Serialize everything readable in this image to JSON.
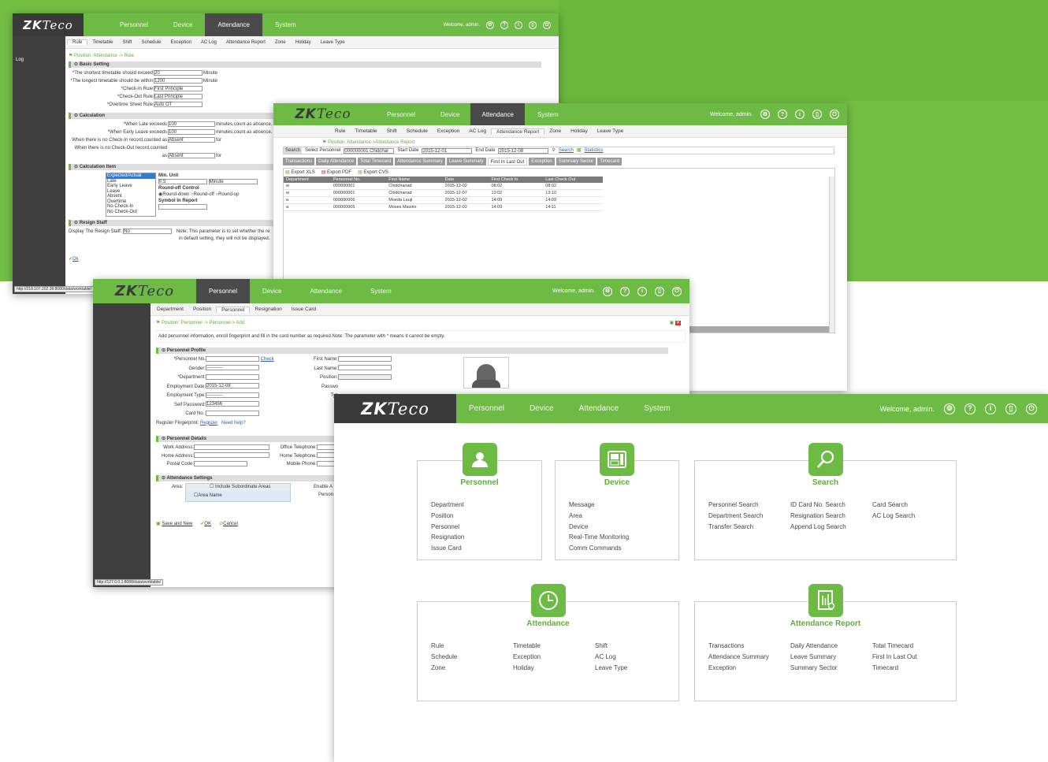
{
  "brand": {
    "zk": "ZK",
    "eco": "Teco"
  },
  "nav": {
    "personnel": "Personnel",
    "device": "Device",
    "attendance": "Attendance",
    "system": "System",
    "welcome": "Welcome, admin."
  },
  "icons": [
    "gear-icon",
    "help-icon",
    "info-icon",
    "device-icon",
    "power-icon"
  ],
  "colors": {
    "green": "#6dbb45",
    "dark": "#3a3a3a",
    "link": "#2a5db0"
  },
  "w1": {
    "subtabs": [
      "Rule",
      "Timetable",
      "Shift",
      "Schedule",
      "Exception",
      "AC Log",
      "Attendance Report",
      "Zone",
      "Holiday",
      "Leave Type"
    ],
    "side": "Log",
    "position": "Position: Attendance -> Rule",
    "sec_basic": "Basic Setting",
    "f1": "The shortest timetable should exceed",
    "f1v": "20",
    "f1u": "Minute",
    "f2": "The longest timetable should be within",
    "f2v": "1200",
    "f2u": "Minute",
    "f3": "Check-In Rule",
    "f3v": "First Principle",
    "f4": "Check-Out Rule",
    "f4v": "Last Principle",
    "f5": "Overtime Sheet Rule",
    "f5v": "Auto OT",
    "sec_calc": "Calculation",
    "c1": "When Late exceeds",
    "c1v": "100",
    "c1u": "minutes,count as absence.",
    "c2": "When Early Leave exceeds",
    "c2v": "100",
    "c2u": "minutes,count as absence.",
    "c3": "When there is no Check-In record,counted as",
    "c3v": "Absent",
    "c3u": "for",
    "c4": "When there is no Check-Out record,counted as",
    "c4v": "Absent",
    "c4u": "for",
    "sec_item": "Calculation Item",
    "items": [
      "Expected/Actual",
      "Late",
      "Early Leave",
      "Leave",
      "Absent",
      "Overtime",
      "No Check-In",
      "No Check-Out"
    ],
    "min_unit": "Min. Unit",
    "min_val": "0.5",
    "min_sel": "Minute",
    "roundoff": "Round-off Control",
    "rd": "Round-down",
    "ro": "Round-off",
    "ru": "Round-up",
    "symbol": "Symbol In Report",
    "sec_resign": "Resign Staff",
    "display": "Display The Resign Staff:",
    "display_v": "No",
    "note": "Note: This parameter is to set whether the re",
    "note2": "in default setting, they will not be displayed.",
    "ok": "Ok",
    "status": "http://218.107.202.36:8080/data/worktable/"
  },
  "w2": {
    "subtabs": [
      "Rule",
      "Timetable",
      "Shift",
      "Schedule",
      "Exception",
      "AC Log",
      "Attendance Report",
      "Zone",
      "Holiday",
      "Leave Type"
    ],
    "position": "Position: Attendance->Attendance Report",
    "search": "Search",
    "select_personnel": "Select Personnel",
    "personnel_val": "000000001 Chidchar",
    "start_label": "Start Date",
    "start_val": "2015-12-01",
    "end_label": "End Date",
    "end_val": "2015-12-08",
    "search_link": "Search",
    "statistics": "Statistics",
    "reptabs": [
      "Transactions",
      "Daily Attendance",
      "Total Timecard",
      "Attendance Summary",
      "Leave Summary",
      "First In Last Out",
      "Exception",
      "Summary Sector",
      "Timecard"
    ],
    "exp_xls": "Export XLS",
    "exp_pdf": "Export PDF",
    "exp_cvs": "Export CVS",
    "cols": [
      "Department",
      "Personnel No.",
      "First Name",
      "Date",
      "First Check In",
      "Last Check Out"
    ],
    "rows": [
      [
        "w",
        "000000001",
        "Chidchanad",
        "2015-12-02",
        "08:02",
        "08:02"
      ],
      [
        "w",
        "000000001",
        "Chidchanad",
        "2015-12-07",
        "13:02",
        "13:10"
      ],
      [
        "a",
        "000000006",
        "Moeda Lauji",
        "2015-12-02",
        "14:09",
        "14:09"
      ],
      [
        "a",
        "000000005",
        "Moses Mawire",
        "2015-12-02",
        "14:09",
        "14:11"
      ]
    ]
  },
  "w3": {
    "subtabs": [
      "Department",
      "Position",
      "Personnel",
      "Resignation",
      "Issue Card"
    ],
    "position": "Position: Personnel -> Personnel-> Add",
    "info": "Add personnel information, enroll fingerprint and fill in the card number as required.Note: The parameter with * means it cannot be empty.",
    "sec_profile": "Personnel Profile",
    "pno": "Personnel No.",
    "check": "Check",
    "gender": "Gender:",
    "gender_v": "----------",
    "dept": "Department:",
    "empdate": "Employment Date:",
    "empdate_v": "2015-12-08",
    "emptype": "Employment Type:",
    "emptype_v": "----------",
    "selfpw": "Self Password:",
    "selfpw_v": "123456",
    "cardno": "Card No.:",
    "regfp": "Register Fingerprint:",
    "register": "Register",
    "needhelp": "Need help?",
    "fname": "First Name:",
    "lname": "Last Name:",
    "pos": "Position:",
    "passw": "Passwo",
    "typ": "Typ",
    "sec_details": "Personnel Details",
    "work": "Work Address:",
    "home": "Home Address:",
    "postal": "Postal Code:",
    "offtel": "Office Telephone:",
    "hometel": "Home Telephone:",
    "mobile": "Mobile Phone:",
    "sec_att": "Attendance Settings",
    "area": "Area:",
    "include_sub": "Include Subordinate Areas",
    "area_name": "Area Name",
    "enable": "Enable A",
    "person": "Person",
    "save_new": "Save and New",
    "ok": "OK",
    "cancel": "Cancel",
    "status": "http://127.0.0.1:8088/data/worktable/"
  },
  "w4": {
    "tiles": {
      "personnel": {
        "title": "Personnel",
        "items": [
          "Department",
          "Position",
          "Personnel",
          "Resignation",
          "Issue Card"
        ]
      },
      "device": {
        "title": "Device",
        "items": [
          "Message",
          "Area",
          "Device",
          "Real-Time Monitoring",
          "Comm Commands"
        ]
      },
      "search": {
        "title": "Search",
        "col1": [
          "Personnel Search",
          "Department Search",
          "Transfer Search"
        ],
        "col2": [
          "ID Card No. Search",
          "Resignation Search",
          "Append Log Search"
        ],
        "col3": [
          "Card Search",
          "AC Log Search"
        ]
      },
      "attendance": {
        "title": "Attendance",
        "col1": [
          "Rule",
          "Schedule",
          "Zone"
        ],
        "col2": [
          "Timetable",
          "Exception",
          "Holiday"
        ],
        "col3": [
          "Shift",
          "AC Log",
          "Leave Type"
        ]
      },
      "report": {
        "title": "Attendance Report",
        "col1": [
          "Transactions",
          "Attendance Summary",
          "Exception"
        ],
        "col2": [
          "Daily Attendance",
          "Leave Summary",
          "Summary Sector"
        ],
        "col3": [
          "Total Timecard",
          "First In Last Out",
          "Timecard"
        ]
      }
    }
  }
}
